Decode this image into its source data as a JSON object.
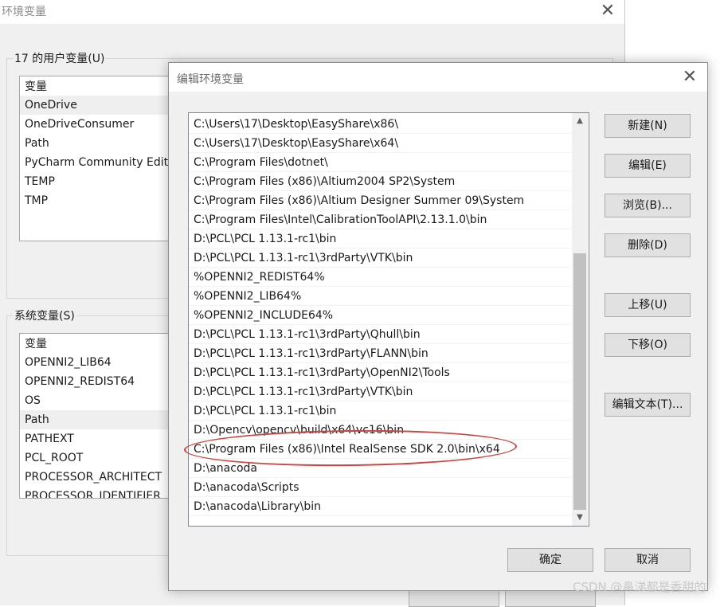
{
  "background_window": {
    "title": "环境变量",
    "close_glyph": "✕",
    "user_vars_label": "17 的用户变量(U)",
    "user_vars": {
      "header": "变量",
      "rows": [
        "OneDrive",
        "OneDriveConsumer",
        "Path",
        "PyCharm Community Edit",
        "TEMP",
        "TMP"
      ],
      "selected": "OneDrive"
    },
    "system_vars_label": "系统变量(S)",
    "system_vars": {
      "header": "变量",
      "rows": [
        "OPENNI2_LIB64",
        "OPENNI2_REDIST64",
        "OS",
        "Path",
        "PATHEXT",
        "PCL_ROOT",
        "PROCESSOR_ARCHITECT",
        "PROCESSOR_IDENTIFIER"
      ],
      "selected": "Path"
    }
  },
  "edit_dialog": {
    "title": "编辑环境变量",
    "close_glyph": "✕",
    "paths": [
      "C:\\Users\\17\\Desktop\\EasyShare\\x86\\",
      "C:\\Users\\17\\Desktop\\EasyShare\\x64\\",
      "C:\\Program Files\\dotnet\\",
      "C:\\Program Files (x86)\\Altium2004 SP2\\System",
      "C:\\Program Files (x86)\\Altium Designer Summer 09\\System",
      "C:\\Program Files\\Intel\\CalibrationToolAPI\\2.13.1.0\\bin",
      "D:\\PCL\\PCL 1.13.1-rc1\\bin",
      "D:\\PCL\\PCL 1.13.1-rc1\\3rdParty\\VTK\\bin",
      "%OPENNI2_REDIST64%",
      "%OPENNI2_LIB64%",
      "%OPENNI2_INCLUDE64%",
      "D:\\PCL\\PCL 1.13.1-rc1\\3rdParty\\Qhull\\bin",
      "D:\\PCL\\PCL 1.13.1-rc1\\3rdParty\\FLANN\\bin",
      "D:\\PCL\\PCL 1.13.1-rc1\\3rdParty\\OpenNI2\\Tools",
      "D:\\PCL\\PCL 1.13.1-rc1\\3rdParty\\VTK\\bin",
      "D:\\PCL\\PCL 1.13.1-rc1\\bin",
      "D:\\Opencv\\opencv\\build\\x64\\vc16\\bin",
      "C:\\Program Files (x86)\\Intel RealSense SDK 2.0\\bin\\x64",
      "D:\\anacoda",
      "D:\\anacoda\\Scripts",
      "D:\\anacoda\\Library\\bin"
    ],
    "scroll_up_glyph": "▲",
    "scroll_down_glyph": "▼",
    "buttons": {
      "new": "新建(N)",
      "edit": "编辑(E)",
      "browse": "浏览(B)...",
      "delete": "删除(D)",
      "move_up": "上移(U)",
      "move_down": "下移(O)",
      "edit_text": "编辑文本(T)...",
      "ok": "确定",
      "cancel": "取消"
    }
  },
  "annotation": {
    "highlighted_path": "C:\\Program Files (x86)\\Intel RealSense SDK 2.0\\bin\\x64",
    "color": "#c8463e"
  },
  "watermark": "CSDN @鼻涕都是香甜的"
}
